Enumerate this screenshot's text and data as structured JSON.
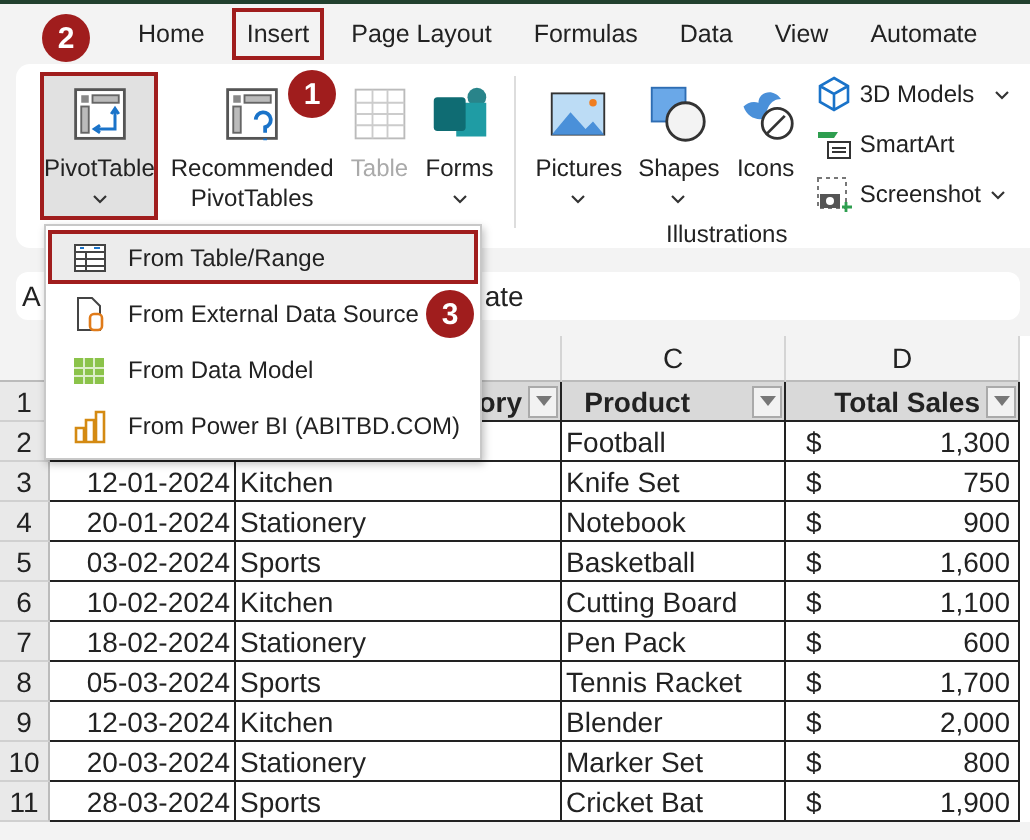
{
  "tabs": [
    {
      "label": "Home",
      "selected": false
    },
    {
      "label": "Insert",
      "selected": true
    },
    {
      "label": "Page Layout",
      "selected": false
    },
    {
      "label": "Formulas",
      "selected": false
    },
    {
      "label": "Data",
      "selected": false
    },
    {
      "label": "View",
      "selected": false
    },
    {
      "label": "Automate",
      "selected": false
    }
  ],
  "ribbon": {
    "large_buttons": [
      {
        "kind": "pivot",
        "lines": [
          "PivotTable"
        ],
        "selected": true,
        "disabled": false,
        "dropdown": true
      },
      {
        "kind": "recommended",
        "lines": [
          "Recommended",
          "PivotTables"
        ],
        "selected": false,
        "disabled": false,
        "dropdown": false
      },
      {
        "kind": "table",
        "lines": [
          "Table"
        ],
        "selected": false,
        "disabled": true,
        "dropdown": false
      },
      {
        "kind": "forms",
        "lines": [
          "Forms"
        ],
        "selected": false,
        "disabled": false,
        "dropdown": true
      },
      {
        "kind": "pictures",
        "lines": [
          "Pictures"
        ],
        "selected": false,
        "disabled": false,
        "dropdown": true
      },
      {
        "kind": "shapes",
        "lines": [
          "Shapes"
        ],
        "selected": false,
        "disabled": false,
        "dropdown": true
      },
      {
        "kind": "icons",
        "lines": [
          "Icons"
        ],
        "selected": false,
        "disabled": false,
        "dropdown": false
      }
    ],
    "small_buttons": [
      {
        "kind": "cube",
        "label": "3D Models",
        "dropdown": true
      },
      {
        "kind": "smartart",
        "label": "SmartArt",
        "dropdown": false
      },
      {
        "kind": "screenshot",
        "label": "Screenshot",
        "dropdown": true
      }
    ],
    "group_label": "Illustrations"
  },
  "formula_bar": {
    "name_box": "A",
    "formula": "ate"
  },
  "sheet": {
    "column_letters": [
      "C",
      "D"
    ],
    "rows": [
      {
        "number": "1",
        "kind": "header",
        "category": "ory",
        "product": "Product",
        "sales": "Total Sales"
      },
      {
        "number": "2",
        "kind": "data",
        "product": "Football",
        "currency": "$",
        "amount": "1,300"
      },
      {
        "number": "3",
        "kind": "data",
        "date": "12-01-2024",
        "category": "Kitchen",
        "product": "Knife Set",
        "currency": "$",
        "amount": "750"
      },
      {
        "number": "4",
        "kind": "data",
        "date": "20-01-2024",
        "category": "Stationery",
        "product": "Notebook",
        "currency": "$",
        "amount": "900"
      },
      {
        "number": "5",
        "kind": "data",
        "date": "03-02-2024",
        "category": "Sports",
        "product": "Basketball",
        "currency": "$",
        "amount": "1,600"
      },
      {
        "number": "6",
        "kind": "data",
        "date": "10-02-2024",
        "category": "Kitchen",
        "product": "Cutting Board",
        "currency": "$",
        "amount": "1,100"
      },
      {
        "number": "7",
        "kind": "data",
        "date": "18-02-2024",
        "category": "Stationery",
        "product": "Pen Pack",
        "currency": "$",
        "amount": "600"
      },
      {
        "number": "8",
        "kind": "data",
        "date": "05-03-2024",
        "category": "Sports",
        "product": "Tennis Racket",
        "currency": "$",
        "amount": "1,700"
      },
      {
        "number": "9",
        "kind": "data",
        "date": "12-03-2024",
        "category": "Kitchen",
        "product": "Blender",
        "currency": "$",
        "amount": "2,000"
      },
      {
        "number": "10",
        "kind": "data",
        "date": "20-03-2024",
        "category": "Stationery",
        "product": "Marker Set",
        "currency": "$",
        "amount": "800"
      },
      {
        "number": "11",
        "kind": "data",
        "date": "28-03-2024",
        "category": "Sports",
        "product": "Cricket Bat",
        "currency": "$",
        "amount": "1,900"
      }
    ]
  },
  "menu": {
    "items": [
      {
        "kind": "range",
        "label": "From Table/Range",
        "selected": true
      },
      {
        "kind": "external",
        "label": "From External Data Source",
        "selected": false
      },
      {
        "kind": "model",
        "label": "From Data Model",
        "selected": false
      },
      {
        "kind": "powerbi",
        "label": "From Power BI (ABITBD.COM)",
        "selected": false
      }
    ]
  },
  "step_badges": [
    {
      "label": "2"
    },
    {
      "label": "1"
    },
    {
      "label": "3"
    }
  ]
}
